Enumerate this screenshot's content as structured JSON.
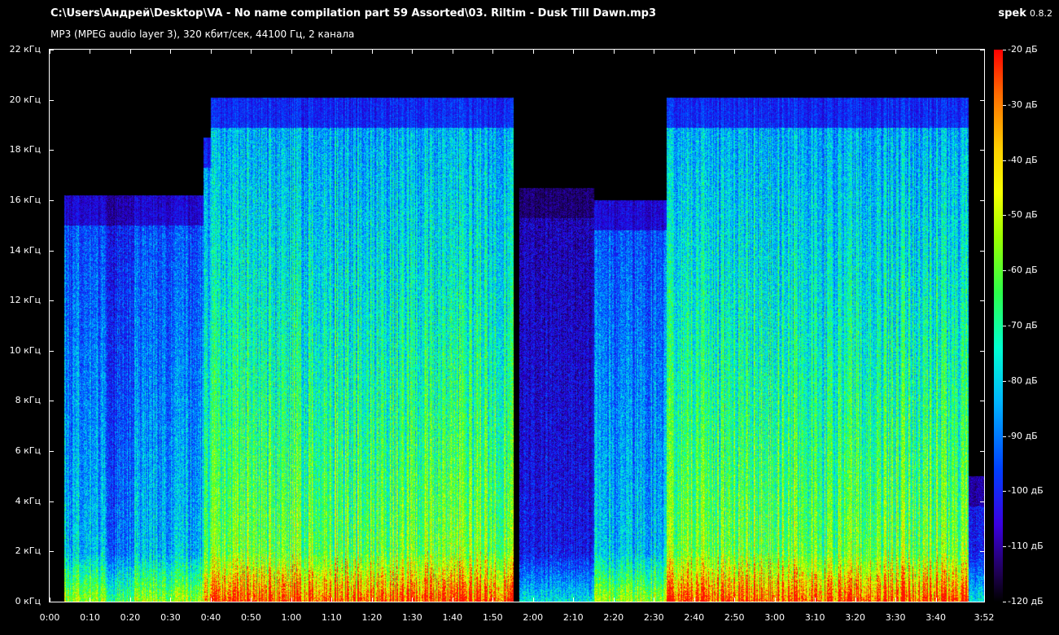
{
  "window": {
    "file_path": "C:\\Users\\Андрей\\Desktop\\VA - No name compilation part 59 Assorted\\03. Riltim - Dusk Till Dawn.mp3",
    "file_info": "MP3 (MPEG audio layer 3), 320 кбит/сек, 44100 Гц, 2 канала",
    "app_name": "spek",
    "app_version": "0.8.2"
  },
  "chart_data": {
    "type": "heatmap",
    "title": "",
    "xlabel": "",
    "ylabel": "",
    "x_range_seconds": [
      0,
      232
    ],
    "y_range_khz": [
      0,
      22
    ],
    "color_range_db": [
      -120,
      -20
    ],
    "y_ticks": [
      "22 кГц",
      "20 кГц",
      "18 кГц",
      "16 кГц",
      "14 кГц",
      "12 кГц",
      "10 кГц",
      "8 кГц",
      "6 кГц",
      "4 кГц",
      "2 кГц",
      "0 кГц"
    ],
    "x_ticks": [
      "0:00",
      "0:10",
      "0:20",
      "0:30",
      "0:40",
      "0:50",
      "1:00",
      "1:10",
      "1:20",
      "1:30",
      "1:40",
      "1:50",
      "2:00",
      "2:10",
      "2:20",
      "2:30",
      "2:40",
      "2:50",
      "3:00",
      "3:10",
      "3:20",
      "3:30",
      "3:40",
      "3:52"
    ],
    "db_ticks": [
      "-20 дБ",
      "-30 дБ",
      "-40 дБ",
      "-50 дБ",
      "-60 дБ",
      "-70 дБ",
      "-80 дБ",
      "-90 дБ",
      "-100 дБ",
      "-110 дБ",
      "-120 дБ"
    ],
    "segments": [
      {
        "start_s": 0,
        "end_s": 3.5,
        "cutoff_khz": 0,
        "energy": 0
      },
      {
        "start_s": 3.5,
        "end_s": 14,
        "cutoff_khz": 16.2,
        "energy": 0.55
      },
      {
        "start_s": 14,
        "end_s": 16,
        "cutoff_khz": 16.2,
        "energy": 0.35
      },
      {
        "start_s": 16,
        "end_s": 21,
        "cutoff_khz": 16.2,
        "energy": 0.45
      },
      {
        "start_s": 21,
        "end_s": 38,
        "cutoff_khz": 16.2,
        "energy": 0.55
      },
      {
        "start_s": 38,
        "end_s": 40,
        "cutoff_khz": 18.5,
        "energy": 0.7
      },
      {
        "start_s": 40,
        "end_s": 115,
        "cutoff_khz": 20.1,
        "energy": 0.8
      },
      {
        "start_s": 115,
        "end_s": 116.5,
        "cutoff_khz": 0,
        "energy": 0
      },
      {
        "start_s": 116.5,
        "end_s": 135,
        "cutoff_khz": 16.5,
        "energy": 0.3
      },
      {
        "start_s": 135,
        "end_s": 153,
        "cutoff_khz": 16.0,
        "energy": 0.55
      },
      {
        "start_s": 153,
        "end_s": 228,
        "cutoff_khz": 20.1,
        "energy": 0.8
      },
      {
        "start_s": 228,
        "end_s": 232,
        "cutoff_khz": 5,
        "energy": 0.3
      }
    ]
  }
}
